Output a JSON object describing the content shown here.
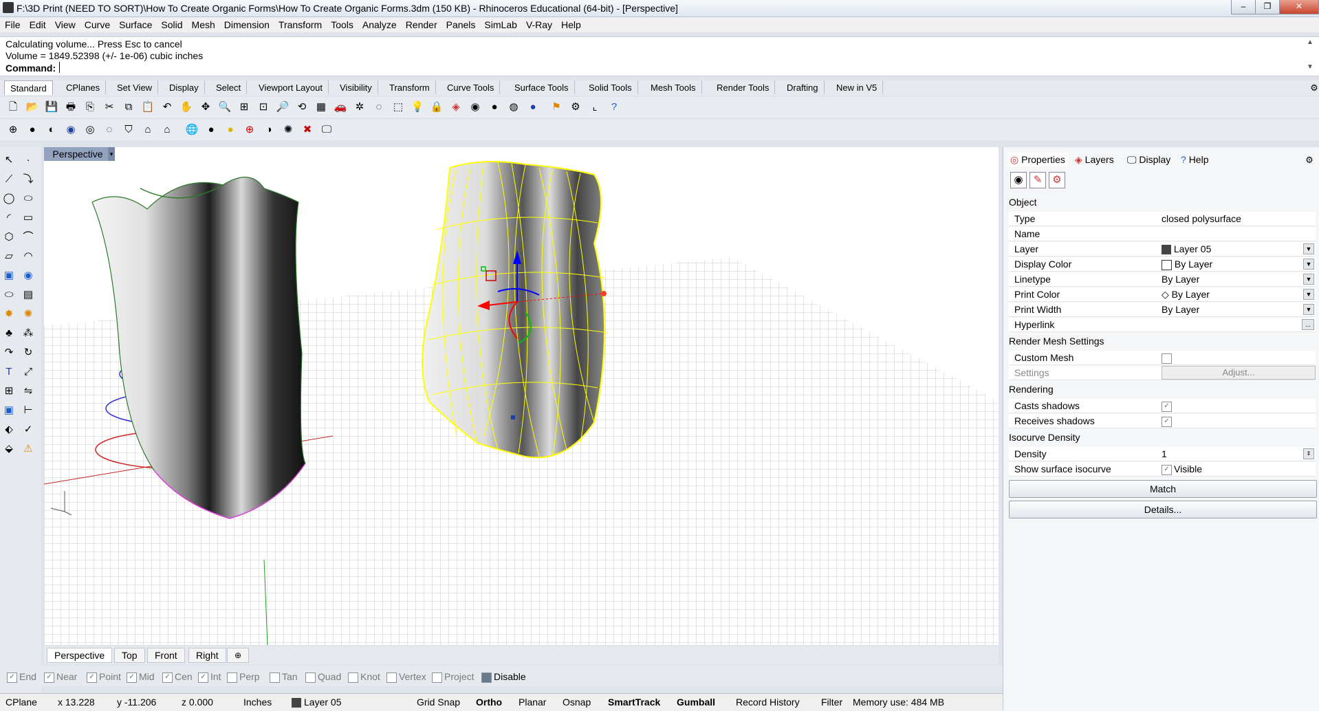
{
  "window": {
    "title": "F:\\3D Print (NEED TO SORT)\\How To Create Organic Forms\\How To Create Organic Forms.3dm (150 KB) - Rhinoceros Educational (64-bit) - [Perspective]"
  },
  "menu": [
    "File",
    "Edit",
    "View",
    "Curve",
    "Surface",
    "Solid",
    "Mesh",
    "Dimension",
    "Transform",
    "Tools",
    "Analyze",
    "Render",
    "Panels",
    "SimLab",
    "V-Ray",
    "Help"
  ],
  "command": {
    "line1": "Calculating volume... Press Esc to cancel",
    "line2": "Volume = 1849.52398 (+/- 1e-06) cubic inches",
    "prompt": "Command:"
  },
  "toolbar_tabs": [
    "Standard",
    "CPlanes",
    "Set View",
    "Display",
    "Select",
    "Viewport Layout",
    "Visibility",
    "Transform",
    "Curve Tools",
    "Surface Tools",
    "Solid Tools",
    "Mesh Tools",
    "Render Tools",
    "Drafting",
    "New in V5"
  ],
  "viewport": {
    "title": "Perspective",
    "tabs": [
      "Perspective",
      "Top",
      "Front",
      "Right",
      "⊕"
    ]
  },
  "osnaps": [
    {
      "label": "End",
      "checked": true
    },
    {
      "label": "Near",
      "checked": true
    },
    {
      "label": "Point",
      "checked": true
    },
    {
      "label": "Mid",
      "checked": true
    },
    {
      "label": "Cen",
      "checked": true
    },
    {
      "label": "Int",
      "checked": true
    },
    {
      "label": "Perp",
      "checked": false
    },
    {
      "label": "Tan",
      "checked": false
    },
    {
      "label": "Quad",
      "checked": false
    },
    {
      "label": "Knot",
      "checked": false
    },
    {
      "label": "Vertex",
      "checked": false
    },
    {
      "label": "Project",
      "checked": false
    },
    {
      "label": "Disable",
      "checked": false
    }
  ],
  "status": {
    "cplane": "CPlane",
    "x": "x 13.228",
    "y": "y -11.206",
    "z": "z 0.000",
    "units": "Inches",
    "layer": "Layer 05",
    "grid_snap": "Grid Snap",
    "ortho": "Ortho",
    "planar": "Planar",
    "osnap": "Osnap",
    "smarttrack": "SmartTrack",
    "gumball": "Gumball",
    "record_history": "Record History",
    "filter": "Filter",
    "memory": "Memory use: 484 MB"
  },
  "panel": {
    "tabs": [
      "Properties",
      "Layers",
      "Display",
      "Help"
    ],
    "sections": {
      "object": "Object",
      "render_mesh": "Render Mesh Settings",
      "rendering": "Rendering",
      "isocurve": "Isocurve Density"
    },
    "properties": {
      "type_label": "Type",
      "type_value": "closed polysurface",
      "name_label": "Name",
      "name_value": "",
      "layer_label": "Layer",
      "layer_value": "Layer 05",
      "display_color_label": "Display Color",
      "display_color_value": "By Layer",
      "linetype_label": "Linetype",
      "linetype_value": "By Layer",
      "print_color_label": "Print Color",
      "print_color_value": "By Layer",
      "print_width_label": "Print Width",
      "print_width_value": "By Layer",
      "hyperlink_label": "Hyperlink",
      "hyperlink_button": "...",
      "custom_mesh_label": "Custom Mesh",
      "settings_label": "Settings",
      "adjust_button": "Adjust...",
      "casts_shadows_label": "Casts shadows",
      "receives_shadows_label": "Receives shadows",
      "density_label": "Density",
      "density_value": "1",
      "show_iso_label": "Show surface isocurve",
      "visible_label": "Visible"
    },
    "match_button": "Match",
    "details_button": "Details..."
  },
  "colors": {
    "viewport_title_bg": "#93a3bf",
    "selection_yellow": "#ffff00",
    "gumball_red": "#ff0000",
    "gumball_green": "#00c000",
    "gumball_blue": "#0000ff"
  }
}
